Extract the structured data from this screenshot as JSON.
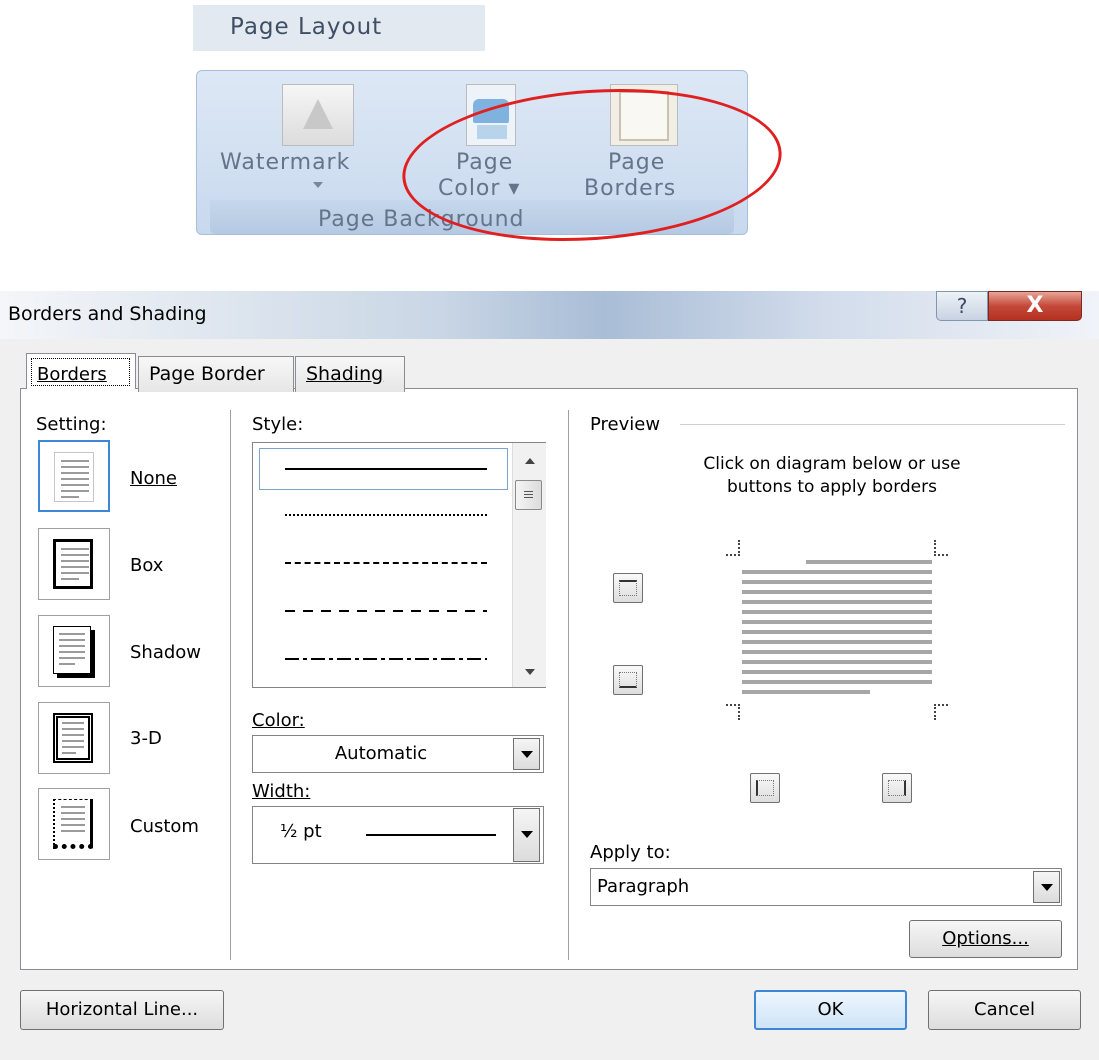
{
  "ribbon": {
    "tab_label": "Page Layout",
    "watermark_label": "Watermark",
    "page_color_label_1": "Page",
    "page_color_label_2": "Color ▾",
    "page_borders_label_1": "Page",
    "page_borders_label_2": "Borders",
    "group_label": "Page Background",
    "highlight_color": "#e02020"
  },
  "dialog": {
    "title": "Borders and Shading",
    "help_glyph": "?",
    "close_glyph": "X",
    "tabs": [
      {
        "label": "Borders",
        "active": true
      },
      {
        "label": "Page Border",
        "active": false
      },
      {
        "label": "Shading",
        "active": false
      }
    ],
    "setting": {
      "heading": "Setting:",
      "options": [
        {
          "label": "None",
          "selected": true
        },
        {
          "label": "Box",
          "selected": false
        },
        {
          "label": "Shadow",
          "selected": false
        },
        {
          "label": "3-D",
          "selected": false
        },
        {
          "label": "Custom",
          "selected": false
        }
      ]
    },
    "style": {
      "heading": "Style:",
      "lines": [
        "solid",
        "dotted",
        "dashed-fine",
        "dashed",
        "dash-dot"
      ]
    },
    "color": {
      "heading": "Color:",
      "value": "Automatic"
    },
    "width": {
      "heading": "Width:",
      "value": "½ pt"
    },
    "preview": {
      "heading": "Preview",
      "instruction_1": "Click on diagram below or use",
      "instruction_2": "buttons to apply borders"
    },
    "apply_to": {
      "heading": "Apply to:",
      "value": "Paragraph"
    },
    "options_button": "Options...",
    "horizontal_line_button": "Horizontal Line...",
    "ok_button": "OK",
    "cancel_button": "Cancel",
    "accent_color": "#3e86d6"
  }
}
